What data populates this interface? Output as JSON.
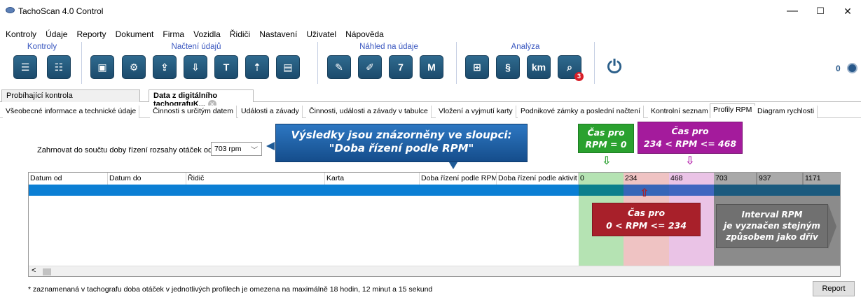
{
  "window": {
    "title": "TachoScan 4.0 Control",
    "min": "—",
    "max": "☐",
    "close": "✕"
  },
  "menu": [
    "Kontroly",
    "Údaje",
    "Reporty",
    "Dokument",
    "Firma",
    "Vozidla",
    "Řidiči",
    "Nastavení",
    "Uživatel",
    "Nápověda"
  ],
  "ribbon": {
    "groups": [
      "Kontroly",
      "Načtení údajů",
      "Náhled na údaje",
      "Analýza"
    ],
    "counter": "0",
    "badge": "3"
  },
  "doc_tabs": [
    "Probíhající kontrola",
    "Data z digitálního tachografuK..."
  ],
  "sub_tabs": [
    "Všeobecné informace a technické údaje",
    "Činnosti s určitým datem",
    "Události a závady",
    "Činnosti, události a závady v tabulce",
    "Vložení a vyjmutí karty",
    "Podnikové zámky a poslední načtení",
    "Kontrolní seznam",
    "Profily RPM",
    "Diagram rychlosti"
  ],
  "filter": {
    "label": "Zahrnovat do součtu doby řízení rozsahy otáček od",
    "value": "703 rpm"
  },
  "grid": {
    "columns": [
      "Datum od",
      "Datum do",
      "Řidič",
      "Karta",
      "Doba řízení podle RPM",
      "Doba řízení podle aktivit"
    ],
    "rpm_columns": [
      "0",
      "234",
      "468",
      "703",
      "937",
      "1171"
    ]
  },
  "callouts": {
    "main_line1": "Výsledky jsou znázorněny ve sloupci:",
    "main_line2": "\"Doba řízení podle RPM\"",
    "green_line1": "Čas pro",
    "green_line2": "RPM = 0",
    "magenta_line1": "Čas pro",
    "magenta_line2": "234 < RPM <= 468",
    "red_line1": "Čas pro",
    "red_line2": "0 < RPM <= 234",
    "gray_line1": "Interval RPM",
    "gray_line2": "je vyznačen stejným",
    "gray_line3": "způsobem jako dřív"
  },
  "colors": {
    "green": "#2aa12f",
    "magenta": "#a41b9c",
    "red": "#a8202a",
    "gray": "#707070",
    "blue": "#1f5b96"
  },
  "footnote": "* zaznamenaná v tachografu doba otáček v jednotlivých profilech je omezena na maximálně 18 hodin, 12 minut a 15 sekund",
  "report_button": "Report"
}
